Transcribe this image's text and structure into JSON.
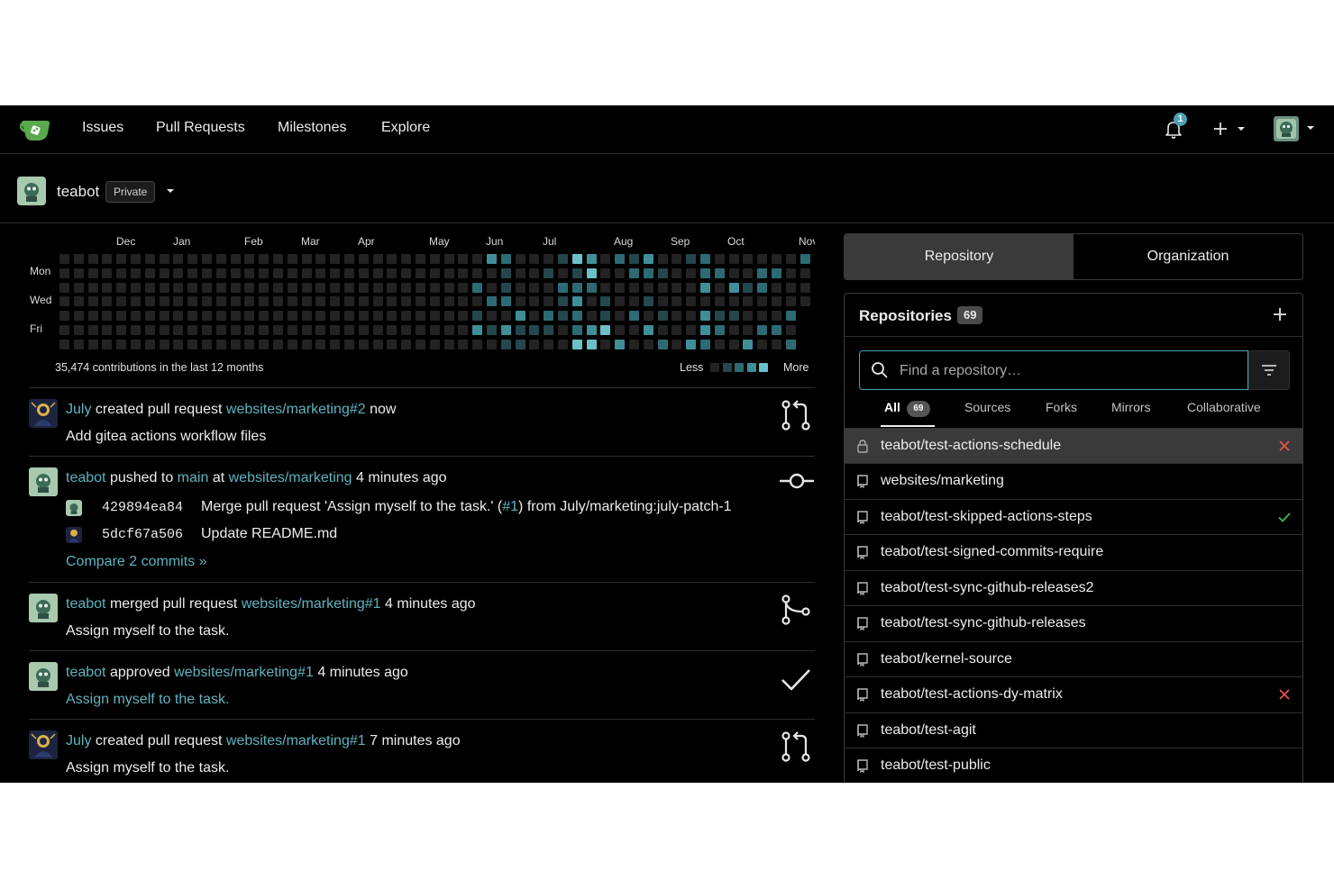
{
  "nav": {
    "items": [
      "Issues",
      "Pull Requests",
      "Milestones",
      "Explore"
    ],
    "notification_count": "1"
  },
  "context": {
    "user": "teabot",
    "visibility": "Private"
  },
  "heatmap": {
    "months": [
      "Dec",
      "Jan",
      "Feb",
      "Mar",
      "Apr",
      "May",
      "Jun",
      "Jul",
      "Aug",
      "Sep",
      "Oct",
      "Nov"
    ],
    "days": [
      "Mon",
      "Wed",
      "Fri"
    ],
    "total_text": "35,474 contributions in the last 12 months",
    "less": "Less",
    "more": "More",
    "colors": [
      "#232323",
      "#24474d",
      "#2c6b73",
      "#3f8f99",
      "#6cc0c8"
    ]
  },
  "feed": [
    {
      "user": "July",
      "action": "created pull request",
      "target": "websites/marketing#2",
      "time": "now",
      "detail": "Add gitea actions workflow files",
      "icon": "pull-request-icon"
    },
    {
      "user": "teabot",
      "action": "pushed to",
      "branch": "main",
      "at": "at",
      "target": "websites/marketing",
      "time": "4 minutes ago",
      "icon": "commit-icon",
      "commits": [
        {
          "sha": "429894ea84",
          "msg_before": "Merge pull request 'Assign myself to the task.' (",
          "msg_link": "#1",
          "msg_after": ") from July/marketing:july-patch-1"
        },
        {
          "sha": "5dcf67a506",
          "msg_before": "Update README.md",
          "msg_link": "",
          "msg_after": ""
        }
      ],
      "compare": "Compare 2 commits »"
    },
    {
      "user": "teabot",
      "action": "merged pull request",
      "target": "websites/marketing#1",
      "time": "4 minutes ago",
      "detail": "Assign myself to the task.",
      "icon": "merge-icon"
    },
    {
      "user": "teabot",
      "action": "approved",
      "target": "websites/marketing#1",
      "time": "4 minutes ago",
      "detail": "Assign myself to the task.",
      "icon": "check-icon"
    },
    {
      "user": "July",
      "action": "created pull request",
      "target": "websites/marketing#1",
      "time": "7 minutes ago",
      "detail": "Assign myself to the task.",
      "icon": "pull-request-icon"
    }
  ],
  "panel": {
    "tabs": [
      "Repository",
      "Organization"
    ],
    "heading": "Repositories",
    "count": "69",
    "search_placeholder": "Find a repository…",
    "filters": [
      {
        "label": "All",
        "count": "69"
      },
      {
        "label": "Sources"
      },
      {
        "label": "Forks"
      },
      {
        "label": "Mirrors"
      },
      {
        "label": "Collaborative"
      }
    ],
    "repos": [
      {
        "name": "teabot/test-actions-schedule",
        "icon": "lock-icon",
        "status": "fail"
      },
      {
        "name": "websites/marketing",
        "icon": "repo-icon",
        "status": ""
      },
      {
        "name": "teabot/test-skipped-actions-steps",
        "icon": "repo-icon",
        "status": "success"
      },
      {
        "name": "teabot/test-signed-commits-require",
        "icon": "repo-icon",
        "status": ""
      },
      {
        "name": "teabot/test-sync-github-releases2",
        "icon": "repo-icon",
        "status": ""
      },
      {
        "name": "teabot/test-sync-github-releases",
        "icon": "repo-icon",
        "status": ""
      },
      {
        "name": "teabot/kernel-source",
        "icon": "repo-icon",
        "status": ""
      },
      {
        "name": "teabot/test-actions-dy-matrix",
        "icon": "repo-icon",
        "status": "fail"
      },
      {
        "name": "teabot/test-agit",
        "icon": "repo-icon",
        "status": ""
      },
      {
        "name": "teabot/test-public",
        "icon": "repo-icon",
        "status": ""
      }
    ],
    "colors": {
      "success": "#3fb950",
      "fail": "#e5534b",
      "accent": "#5fb3bf"
    }
  }
}
